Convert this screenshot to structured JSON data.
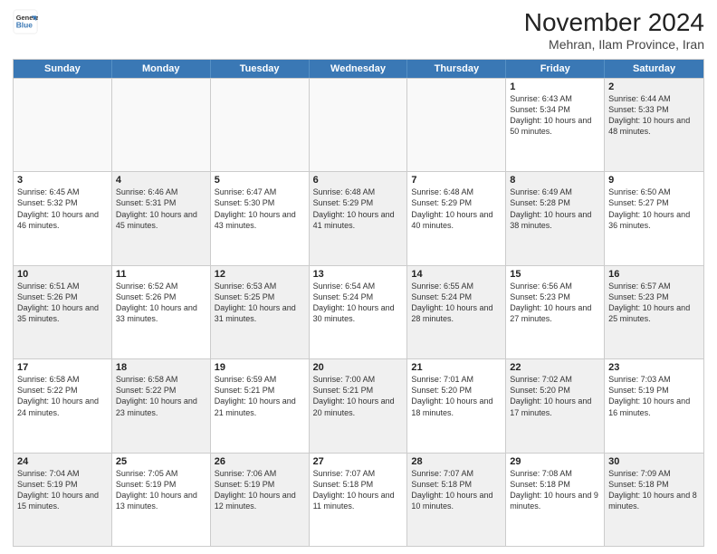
{
  "logo": {
    "line1": "General",
    "line2": "Blue"
  },
  "title": "November 2024",
  "location": "Mehran, Ilam Province, Iran",
  "weekdays": [
    "Sunday",
    "Monday",
    "Tuesday",
    "Wednesday",
    "Thursday",
    "Friday",
    "Saturday"
  ],
  "rows": [
    [
      {
        "day": "",
        "info": "",
        "empty": true
      },
      {
        "day": "",
        "info": "",
        "empty": true
      },
      {
        "day": "",
        "info": "",
        "empty": true
      },
      {
        "day": "",
        "info": "",
        "empty": true
      },
      {
        "day": "",
        "info": "",
        "empty": true
      },
      {
        "day": "1",
        "info": "Sunrise: 6:43 AM\nSunset: 5:34 PM\nDaylight: 10 hours and 50 minutes."
      },
      {
        "day": "2",
        "info": "Sunrise: 6:44 AM\nSunset: 5:33 PM\nDaylight: 10 hours and 48 minutes.",
        "shaded": true
      }
    ],
    [
      {
        "day": "3",
        "info": "Sunrise: 6:45 AM\nSunset: 5:32 PM\nDaylight: 10 hours and 46 minutes."
      },
      {
        "day": "4",
        "info": "Sunrise: 6:46 AM\nSunset: 5:31 PM\nDaylight: 10 hours and 45 minutes.",
        "shaded": true
      },
      {
        "day": "5",
        "info": "Sunrise: 6:47 AM\nSunset: 5:30 PM\nDaylight: 10 hours and 43 minutes."
      },
      {
        "day": "6",
        "info": "Sunrise: 6:48 AM\nSunset: 5:29 PM\nDaylight: 10 hours and 41 minutes.",
        "shaded": true
      },
      {
        "day": "7",
        "info": "Sunrise: 6:48 AM\nSunset: 5:29 PM\nDaylight: 10 hours and 40 minutes."
      },
      {
        "day": "8",
        "info": "Sunrise: 6:49 AM\nSunset: 5:28 PM\nDaylight: 10 hours and 38 minutes.",
        "shaded": true
      },
      {
        "day": "9",
        "info": "Sunrise: 6:50 AM\nSunset: 5:27 PM\nDaylight: 10 hours and 36 minutes."
      }
    ],
    [
      {
        "day": "10",
        "info": "Sunrise: 6:51 AM\nSunset: 5:26 PM\nDaylight: 10 hours and 35 minutes.",
        "shaded": true
      },
      {
        "day": "11",
        "info": "Sunrise: 6:52 AM\nSunset: 5:26 PM\nDaylight: 10 hours and 33 minutes."
      },
      {
        "day": "12",
        "info": "Sunrise: 6:53 AM\nSunset: 5:25 PM\nDaylight: 10 hours and 31 minutes.",
        "shaded": true
      },
      {
        "day": "13",
        "info": "Sunrise: 6:54 AM\nSunset: 5:24 PM\nDaylight: 10 hours and 30 minutes."
      },
      {
        "day": "14",
        "info": "Sunrise: 6:55 AM\nSunset: 5:24 PM\nDaylight: 10 hours and 28 minutes.",
        "shaded": true
      },
      {
        "day": "15",
        "info": "Sunrise: 6:56 AM\nSunset: 5:23 PM\nDaylight: 10 hours and 27 minutes."
      },
      {
        "day": "16",
        "info": "Sunrise: 6:57 AM\nSunset: 5:23 PM\nDaylight: 10 hours and 25 minutes.",
        "shaded": true
      }
    ],
    [
      {
        "day": "17",
        "info": "Sunrise: 6:58 AM\nSunset: 5:22 PM\nDaylight: 10 hours and 24 minutes."
      },
      {
        "day": "18",
        "info": "Sunrise: 6:58 AM\nSunset: 5:22 PM\nDaylight: 10 hours and 23 minutes.",
        "shaded": true
      },
      {
        "day": "19",
        "info": "Sunrise: 6:59 AM\nSunset: 5:21 PM\nDaylight: 10 hours and 21 minutes."
      },
      {
        "day": "20",
        "info": "Sunrise: 7:00 AM\nSunset: 5:21 PM\nDaylight: 10 hours and 20 minutes.",
        "shaded": true
      },
      {
        "day": "21",
        "info": "Sunrise: 7:01 AM\nSunset: 5:20 PM\nDaylight: 10 hours and 18 minutes."
      },
      {
        "day": "22",
        "info": "Sunrise: 7:02 AM\nSunset: 5:20 PM\nDaylight: 10 hours and 17 minutes.",
        "shaded": true
      },
      {
        "day": "23",
        "info": "Sunrise: 7:03 AM\nSunset: 5:19 PM\nDaylight: 10 hours and 16 minutes."
      }
    ],
    [
      {
        "day": "24",
        "info": "Sunrise: 7:04 AM\nSunset: 5:19 PM\nDaylight: 10 hours and 15 minutes.",
        "shaded": true
      },
      {
        "day": "25",
        "info": "Sunrise: 7:05 AM\nSunset: 5:19 PM\nDaylight: 10 hours and 13 minutes."
      },
      {
        "day": "26",
        "info": "Sunrise: 7:06 AM\nSunset: 5:19 PM\nDaylight: 10 hours and 12 minutes.",
        "shaded": true
      },
      {
        "day": "27",
        "info": "Sunrise: 7:07 AM\nSunset: 5:18 PM\nDaylight: 10 hours and 11 minutes."
      },
      {
        "day": "28",
        "info": "Sunrise: 7:07 AM\nSunset: 5:18 PM\nDaylight: 10 hours and 10 minutes.",
        "shaded": true
      },
      {
        "day": "29",
        "info": "Sunrise: 7:08 AM\nSunset: 5:18 PM\nDaylight: 10 hours and 9 minutes."
      },
      {
        "day": "30",
        "info": "Sunrise: 7:09 AM\nSunset: 5:18 PM\nDaylight: 10 hours and 8 minutes.",
        "shaded": true
      }
    ]
  ]
}
